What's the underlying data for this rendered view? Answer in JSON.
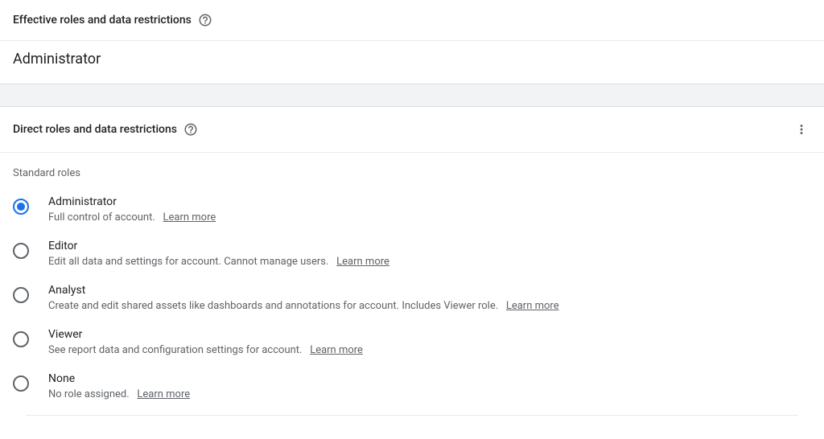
{
  "effective": {
    "title": "Effective roles and data restrictions",
    "current_role": "Administrator"
  },
  "direct": {
    "title": "Direct roles and data restrictions"
  },
  "group_label": "Standard roles",
  "learn_more_text": "Learn more",
  "roles": [
    {
      "id": "administrator",
      "name": "Administrator",
      "desc": "Full control of account.",
      "selected": true
    },
    {
      "id": "editor",
      "name": "Editor",
      "desc": "Edit all data and settings for account. Cannot manage users.",
      "selected": false
    },
    {
      "id": "analyst",
      "name": "Analyst",
      "desc": "Create and edit shared assets like dashboards and annotations for account. Includes Viewer role.",
      "selected": false
    },
    {
      "id": "viewer",
      "name": "Viewer",
      "desc": "See report data and configuration settings for account.",
      "selected": false
    },
    {
      "id": "none",
      "name": "None",
      "desc": "No role assigned.",
      "selected": false
    }
  ]
}
